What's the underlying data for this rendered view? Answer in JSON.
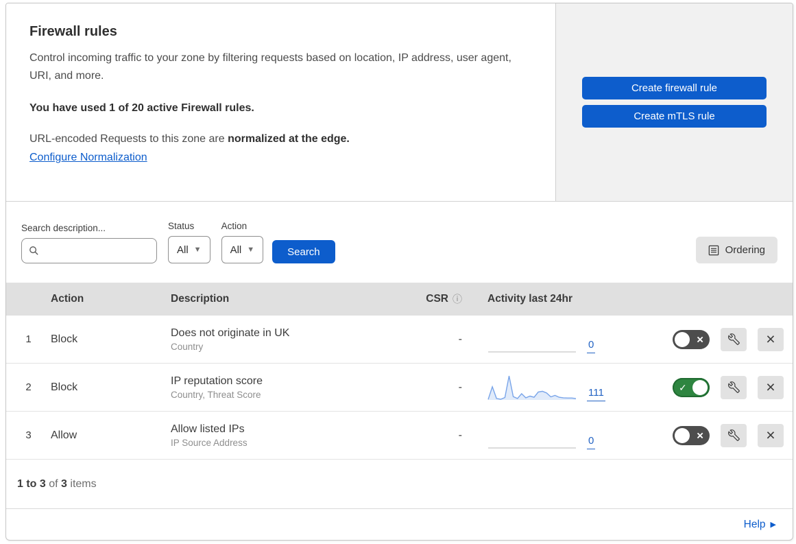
{
  "intro": {
    "title": "Firewall rules",
    "description": "Control incoming traffic to your zone by filtering requests based on location, IP address, user agent, URI, and more.",
    "usage_note": "You have used 1 of 20 active Firewall rules.",
    "normalization_prefix": "URL-encoded Requests to this zone are ",
    "normalization_bold": "normalized at the edge.",
    "normalization_link": "Configure Normalization"
  },
  "actions_panel": {
    "create_firewall_label": "Create firewall rule",
    "create_mtls_label": "Create mTLS rule"
  },
  "filters": {
    "search_label": "Search description...",
    "search_value": "",
    "status_label": "Status",
    "status_value": "All",
    "action_label": "Action",
    "action_value": "All",
    "search_button_label": "Search",
    "ordering_button_label": "Ordering"
  },
  "table": {
    "headers": {
      "action": "Action",
      "description": "Description",
      "csr": "CSR",
      "csr_info_icon": "ⓘ",
      "activity": "Activity last 24hr"
    },
    "rows": [
      {
        "priority": "1",
        "action": "Block",
        "description": "Does not originate in UK",
        "criteria": "Country",
        "csr": "-",
        "activity_count": "0",
        "enabled": false,
        "sparkline": null
      },
      {
        "priority": "2",
        "action": "Block",
        "description": "IP reputation score",
        "criteria": "Country, Threat Score",
        "csr": "-",
        "activity_count": "111",
        "enabled": true,
        "sparkline": [
          2,
          55,
          6,
          3,
          10,
          100,
          14,
          6,
          26,
          9,
          16,
          11,
          33,
          36,
          29,
          13,
          19,
          11,
          9,
          8,
          8,
          6
        ]
      },
      {
        "priority": "3",
        "action": "Allow",
        "description": "Allow listed IPs",
        "criteria": "IP Source Address",
        "csr": "-",
        "activity_count": "0",
        "enabled": false,
        "sparkline": null
      }
    ]
  },
  "footer": {
    "count_range": "1 to 3",
    "count_of": " of ",
    "count_total": "3",
    "count_items": " items",
    "help_label": "Help",
    "help_arrow": "▶"
  },
  "colors": {
    "primary_blue": "#0d5dcc",
    "link_blue": "#2464c4",
    "toggle_on_green": "#2e8540",
    "toggle_off_gray": "#4d4d4d",
    "sparkline_blue": "#78a4e9",
    "panel_gray": "#f1f1f1",
    "table_header_gray": "#e0e0e0"
  }
}
